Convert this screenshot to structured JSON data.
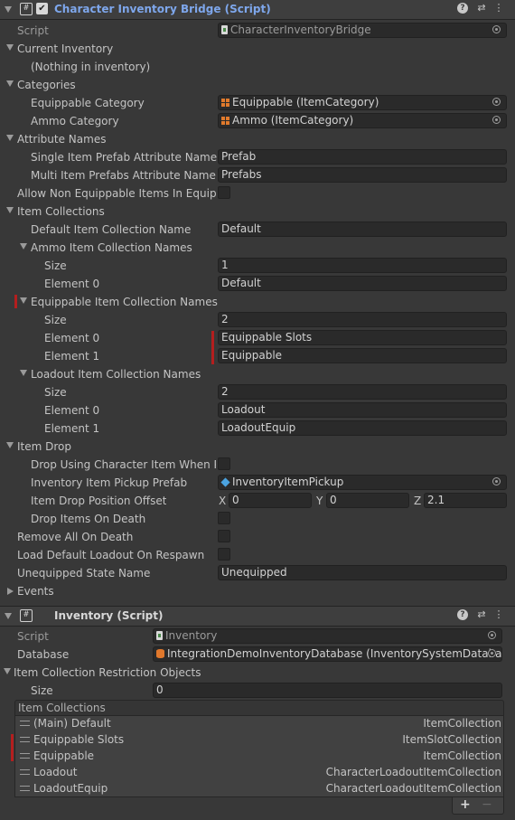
{
  "bridge": {
    "title": "Character Inventory Bridge (Script)",
    "script_label": "Script",
    "script_value": "CharacterInventoryBridge",
    "current_inventory_label": "Current Inventory",
    "nothing_in_inventory": "(Nothing in inventory)",
    "categories_label": "Categories",
    "equippable_category_label": "Equippable Category",
    "equippable_category_value": "Equippable (ItemCategory)",
    "ammo_category_label": "Ammo Category",
    "ammo_category_value": "Ammo (ItemCategory)",
    "attribute_names_label": "Attribute Names",
    "single_prefab_label": "Single Item Prefab Attribute Name",
    "single_prefab_value": "Prefab",
    "multi_prefabs_label": "Multi Item Prefabs Attribute Name",
    "multi_prefabs_value": "Prefabs",
    "allow_non_equippable_label": "Allow Non Equippable Items In Equippab",
    "item_collections_label": "Item Collections",
    "default_collection_label": "Default Item Collection Name",
    "default_collection_value": "Default",
    "ammo_names_label": "Ammo Item Collection Names",
    "ammo_size_label": "Size",
    "ammo_size_value": "1",
    "ammo_el0_label": "Element 0",
    "ammo_el0_value": "Default",
    "equip_names_label": "Equippable Item Collection Names",
    "equip_size_label": "Size",
    "equip_size_value": "2",
    "equip_el0_label": "Element 0",
    "equip_el0_value": "Equippable Slots",
    "equip_el1_label": "Element 1",
    "equip_el1_value": "Equippable",
    "loadout_names_label": "Loadout Item Collection Names",
    "loadout_size_label": "Size",
    "loadout_size_value": "2",
    "loadout_el0_label": "Element 0",
    "loadout_el0_value": "Loadout",
    "loadout_el1_label": "Element 1",
    "loadout_el1_value": "LoadoutEquip",
    "item_drop_label": "Item Drop",
    "drop_using_label": "Drop Using Character Item When Pos",
    "pickup_prefab_label": "Inventory Item Pickup Prefab",
    "pickup_prefab_value": "InventoryItemPickup",
    "drop_offset_label": "Item Drop Position Offset",
    "offset_x_label": "X",
    "offset_x_value": "0",
    "offset_y_label": "Y",
    "offset_y_value": "0",
    "offset_z_label": "Z",
    "offset_z_value": "2.1",
    "drop_on_death_label": "Drop Items On Death",
    "remove_all_label": "Remove All On Death",
    "load_default_label": "Load Default Loadout On Respawn",
    "unequipped_label": "Unequipped State Name",
    "unequipped_value": "Unequipped",
    "events_label": "Events"
  },
  "inventory": {
    "title": "Inventory (Script)",
    "script_label": "Script",
    "script_value": "Inventory",
    "database_label": "Database",
    "database_value": "IntegrationDemoInventoryDatabase (InventorySystemDatabase",
    "restriction_label": "Item Collection Restriction Objects",
    "size_label": "Size",
    "size_value": "0",
    "collections_header": "Item Collections",
    "collections": [
      {
        "name": "(Main) Default",
        "type": "ItemCollection"
      },
      {
        "name": "Equippable Slots",
        "type": "ItemSlotCollection"
      },
      {
        "name": "Equippable",
        "type": "ItemCollection"
      },
      {
        "name": "Loadout",
        "type": "CharacterLoadoutItemCollection"
      },
      {
        "name": "LoadoutEquip",
        "type": "CharacterLoadoutItemCollection"
      }
    ],
    "add_label": "+",
    "remove_label": "−"
  },
  "icons": {
    "help": "?",
    "settings": "⇄",
    "menu": "⋮",
    "check": "✔"
  },
  "colors": {
    "background": "#383838",
    "field": "#2a2a2a",
    "title_blue": "#7ea7ec",
    "marker_red": "#b41e1e"
  }
}
